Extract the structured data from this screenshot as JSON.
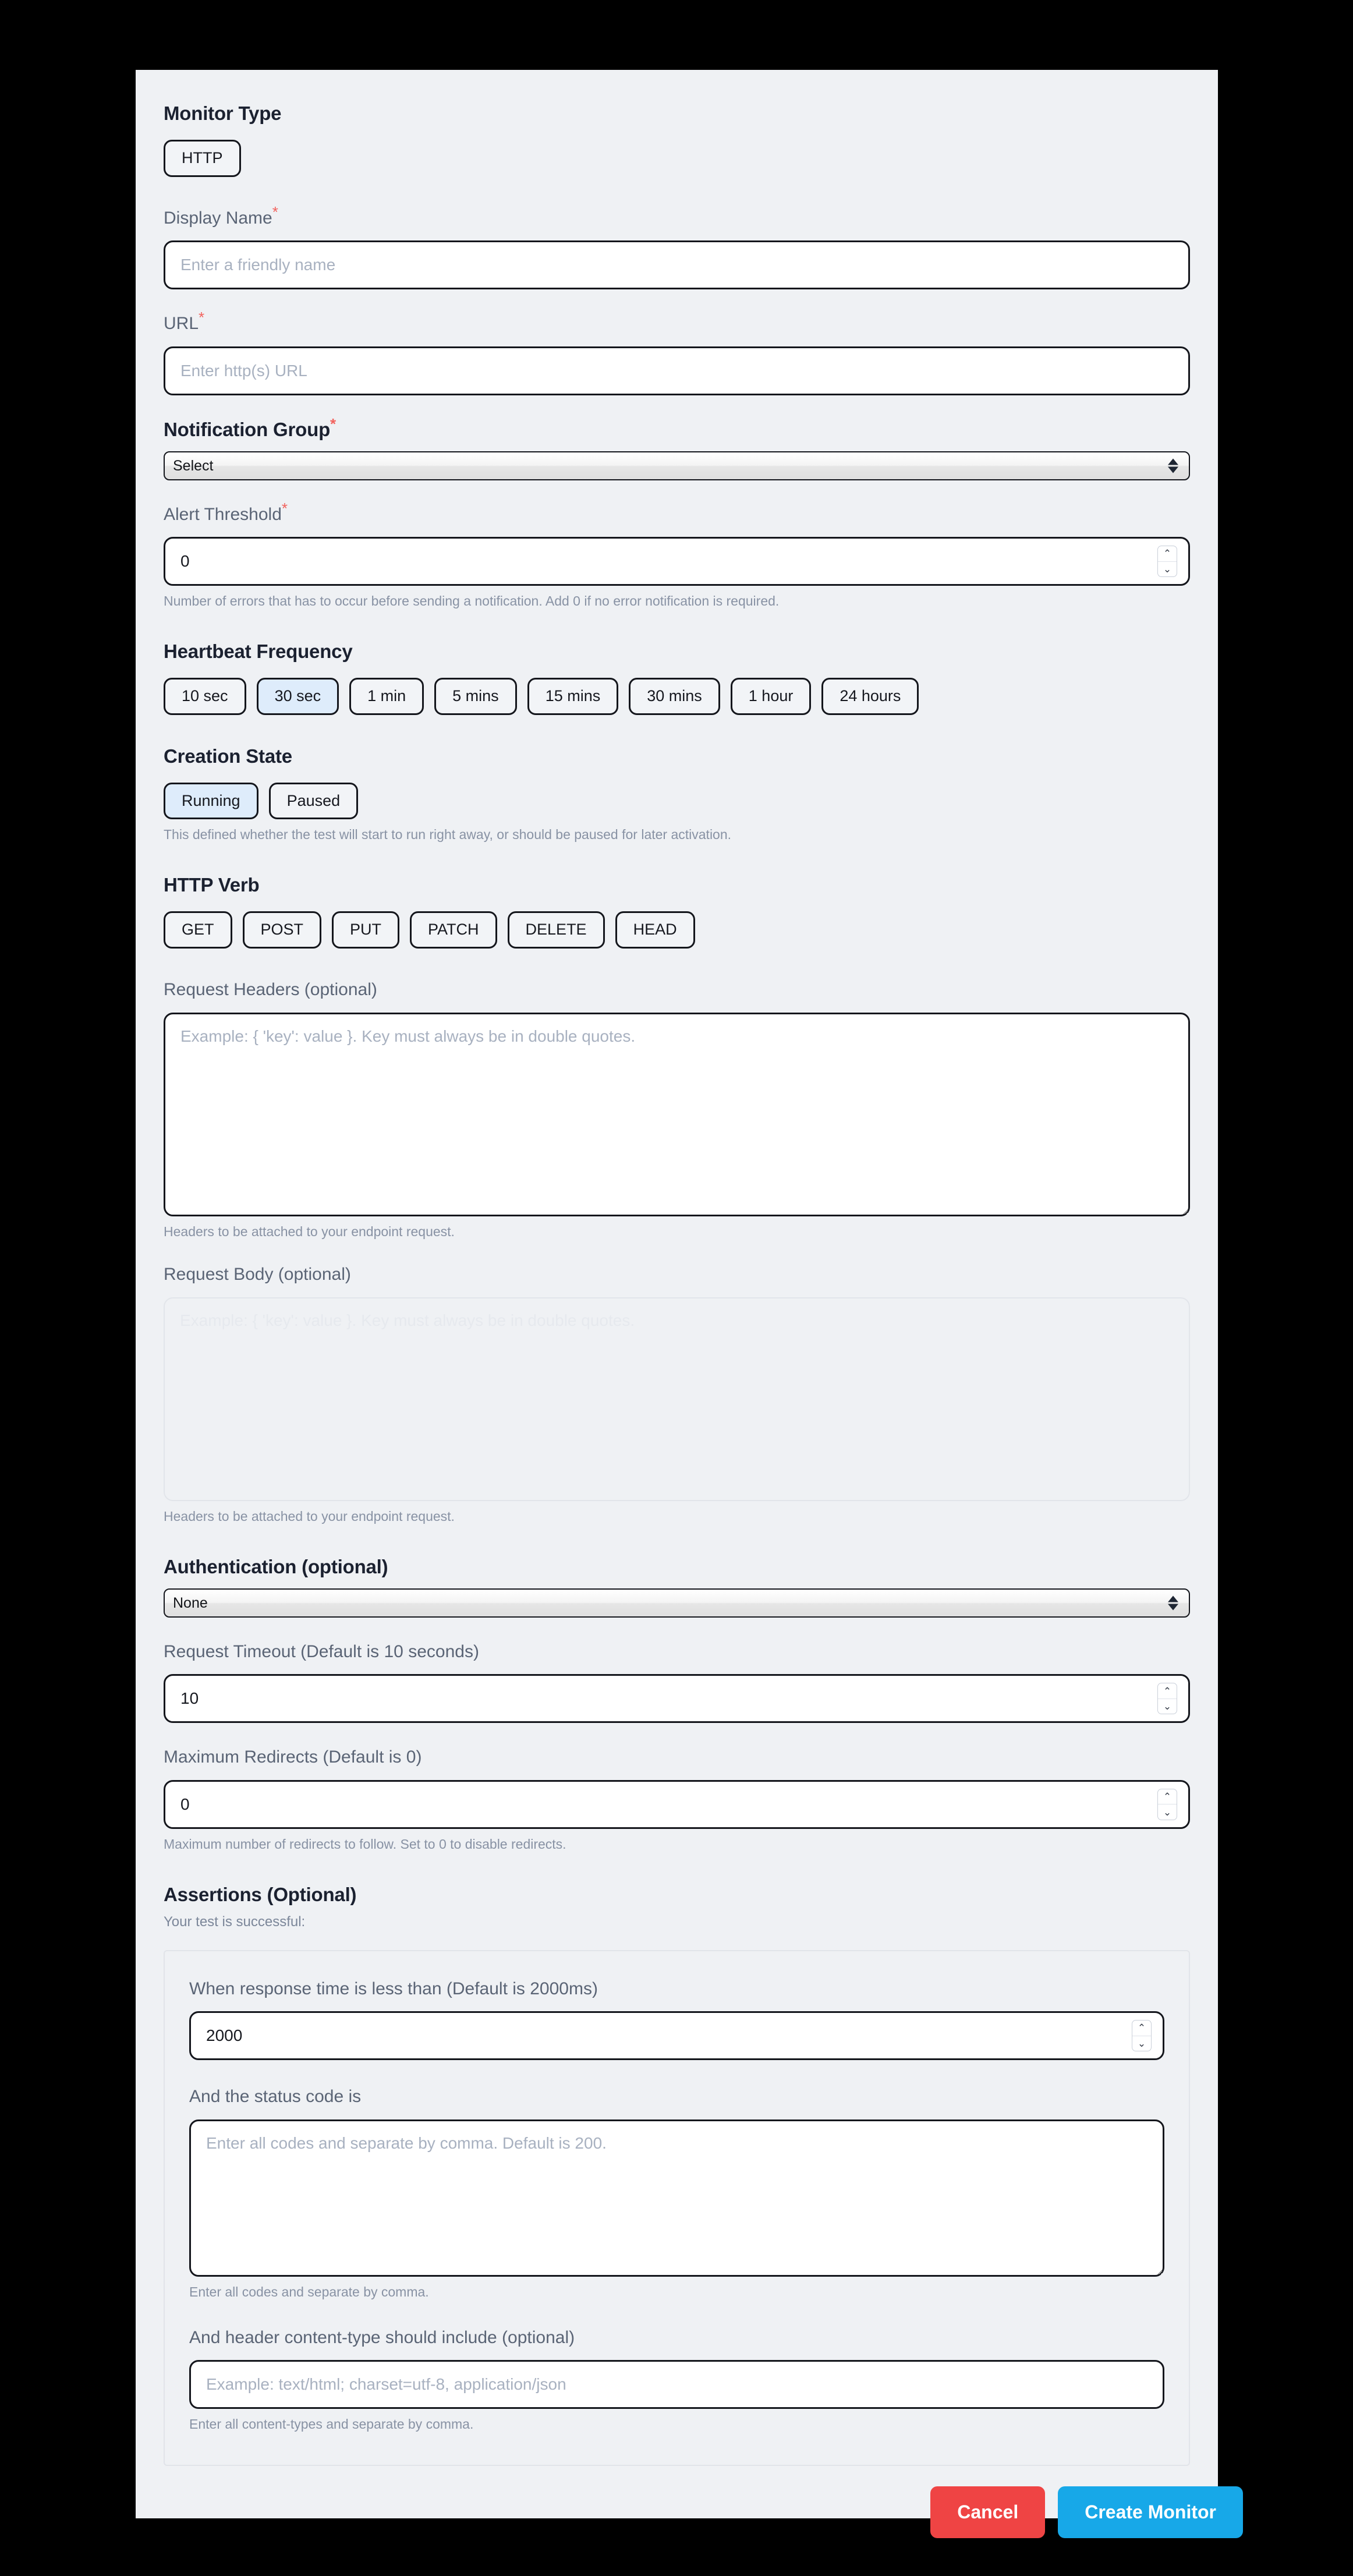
{
  "colors": {
    "page_background": "#000000",
    "panel_background": "#eff1f4",
    "selected_pill": "#deecfb",
    "required_star": "#f2635e",
    "cancel_button": "#ef4444",
    "create_button": "#17a8e8",
    "label_text": "#5a6475",
    "heading_text": "#1b2130",
    "helper_text": "#8892a4",
    "placeholder_text": "#a8b1c0"
  },
  "monitor_type": {
    "title": "Monitor Type",
    "options": [
      "HTTP"
    ],
    "selected": "HTTP"
  },
  "display_name": {
    "label": "Display Name",
    "required_mark": "*",
    "placeholder": "Enter a friendly name",
    "value": ""
  },
  "url": {
    "label": "URL",
    "required_mark": "*",
    "placeholder": "Enter http(s) URL",
    "value": ""
  },
  "notification_group": {
    "label": "Notification Group",
    "required_mark": "*",
    "selected": "Select",
    "options": [
      "Select"
    ]
  },
  "alert_threshold": {
    "label": "Alert Threshold",
    "required_mark": "*",
    "value": "0",
    "helper": "Number of errors that has to occur before sending a notification. Add 0 if no error notification is required."
  },
  "heartbeat_frequency": {
    "title": "Heartbeat Frequency",
    "options": [
      "10 sec",
      "30 sec",
      "1 min",
      "5 mins",
      "15 mins",
      "30 mins",
      "1 hour",
      "24 hours"
    ],
    "selected": "30 sec"
  },
  "creation_state": {
    "title": "Creation State",
    "options": [
      "Running",
      "Paused"
    ],
    "selected": "Running",
    "helper": "This defined whether the test will start to run right away, or should be paused for later activation."
  },
  "http_verb": {
    "title": "HTTP Verb",
    "options": [
      "GET",
      "POST",
      "PUT",
      "PATCH",
      "DELETE",
      "HEAD"
    ],
    "selected": "GET"
  },
  "request_headers": {
    "label": "Request Headers (optional)",
    "placeholder": "Example: { 'key': value }. Key must always be in double quotes.",
    "value": "",
    "helper": "Headers to be attached to your endpoint request."
  },
  "request_body": {
    "label": "Request Body (optional)",
    "placeholder": "Example: { 'key': value }. Key must always be in double quotes.",
    "value": "",
    "helper": "Headers to be attached to your endpoint request.",
    "disabled": true
  },
  "authentication": {
    "title": "Authentication (optional)",
    "selected": "None",
    "options": [
      "None"
    ]
  },
  "request_timeout": {
    "label": "Request Timeout (Default is 10 seconds)",
    "value": "10"
  },
  "maximum_redirects": {
    "label": "Maximum Redirects (Default is 0)",
    "value": "0",
    "helper": "Maximum number of redirects to follow. Set to 0 to disable redirects."
  },
  "assertions": {
    "title": "Assertions (Optional)",
    "subtitle": "Your test is successful:",
    "response_time": {
      "label": "When response time is less than (Default is 2000ms)",
      "value": "2000"
    },
    "status_code": {
      "label": "And the status code is",
      "placeholder": "Enter all codes and separate by comma. Default is 200.",
      "value": "",
      "helper": "Enter all codes and separate by comma."
    },
    "content_type": {
      "label": "And header content-type should include (optional)",
      "placeholder": "Example: text/html; charset=utf-8, application/json",
      "value": "",
      "helper": "Enter all content-types and separate by comma."
    }
  },
  "footer": {
    "cancel_label": "Cancel",
    "create_label": "Create Monitor"
  },
  "icons": {
    "spinner_up": "⌃",
    "spinner_down": "⌄"
  }
}
